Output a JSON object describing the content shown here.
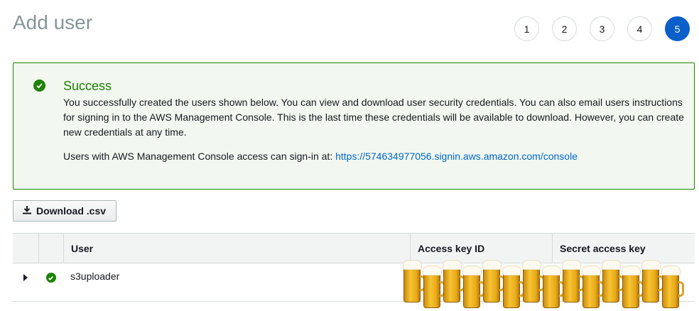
{
  "page": {
    "title": "Add user"
  },
  "steps": [
    "1",
    "2",
    "3",
    "4",
    "5"
  ],
  "active_step": "5",
  "alert": {
    "title": "Success",
    "body": "You successfully created the users shown below. You can view and download user security credentials. You can also email users instructions for signing in to the AWS Management Console. This is the last time these credentials will be available to download. However, you can create new credentials at any time.",
    "signin_prefix": "Users with AWS Management Console access can sign-in at: ",
    "signin_url": "https://574634977056.signin.aws.amazon.com/console",
    "status_color": "#1d8102"
  },
  "toolbar": {
    "download_label": "Download .csv",
    "download_icon": "download-icon"
  },
  "table": {
    "columns": [
      "User",
      "Access key ID",
      "Secret access key"
    ],
    "rows": [
      {
        "user": "s3uploader",
        "status_icon": "success-check-icon",
        "expand_icon": "caret-right-icon"
      }
    ]
  },
  "redaction": {
    "icon": "beer-mug-icon"
  },
  "colors": {
    "accent": "#0a5fc8",
    "link": "#0066cc",
    "success": "#1d8102"
  }
}
